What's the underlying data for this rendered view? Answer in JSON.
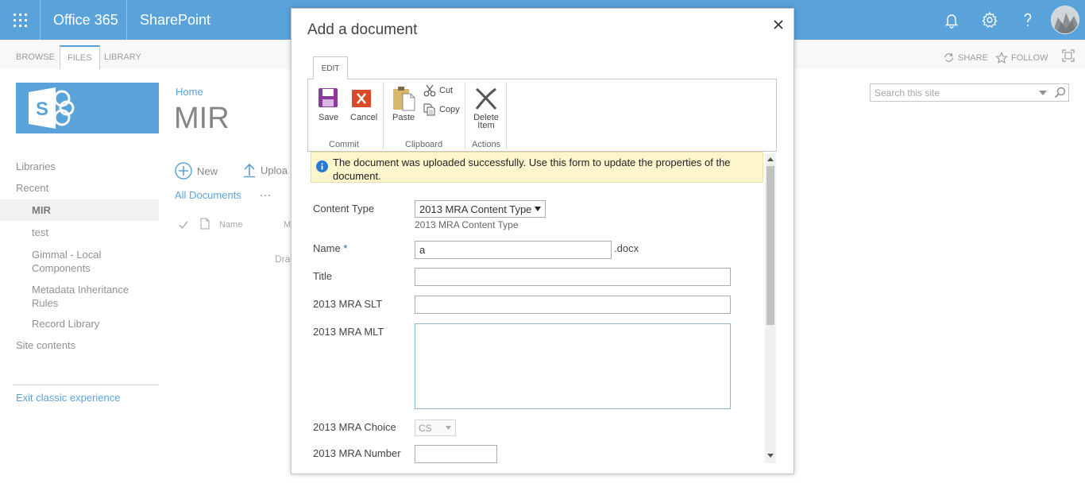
{
  "suite": {
    "app1": "Office 365",
    "app2": "SharePoint"
  },
  "ribbon_tabs": {
    "browse": "BROWSE",
    "files": "FILES",
    "library": "LIBRARY"
  },
  "ribbon_right": {
    "share": "SHARE",
    "follow": "FOLLOW"
  },
  "search": {
    "placeholder": "Search this site"
  },
  "nav": {
    "libraries": "Libraries",
    "recent": "Recent",
    "items": [
      "MIR",
      "test",
      "Gimmal - Local Components",
      "Metadata Inheritance Rules",
      "Record Library"
    ],
    "site_contents": "Site contents",
    "exit": "Exit classic experience"
  },
  "page": {
    "breadcrumb": "Home",
    "title": "MIR",
    "new_label": "New",
    "upload_label": "Uploa",
    "view_label": "All Documents",
    "more_label": "…",
    "col_name": "Name",
    "col_m": "M",
    "drag_text": "Drag"
  },
  "dialog": {
    "title": "Add a document",
    "edit_tab": "EDIT",
    "buttons": {
      "save": "Save",
      "cancel": "Cancel",
      "paste": "Paste",
      "cut": "Cut",
      "copy": "Copy",
      "delete_line1": "Delete",
      "delete_line2": "Item"
    },
    "groups": {
      "commit": "Commit",
      "clipboard": "Clipboard",
      "actions": "Actions"
    },
    "info": "The document was uploaded successfully. Use this form to update the properties of the document.",
    "fields": {
      "content_type_label": "Content Type",
      "content_type_value": "2013 MRA Content Type",
      "content_type_sub": "2013  MRA Content Type",
      "name_label": "Name",
      "name_required": "*",
      "name_value": "a",
      "name_ext": ".docx",
      "title_label": "Title",
      "slt_label": "2013 MRA SLT",
      "mlt_label": "2013 MRA MLT",
      "choice_label": "2013 MRA Choice",
      "choice_value": "CS",
      "number_label": "2013 MRA Number"
    }
  },
  "colors": {
    "brand": "#0072c6",
    "info_bg": "#fdf6cd",
    "save_icon": "#8a3c9c",
    "cancel_icon": "#d84a2a"
  }
}
